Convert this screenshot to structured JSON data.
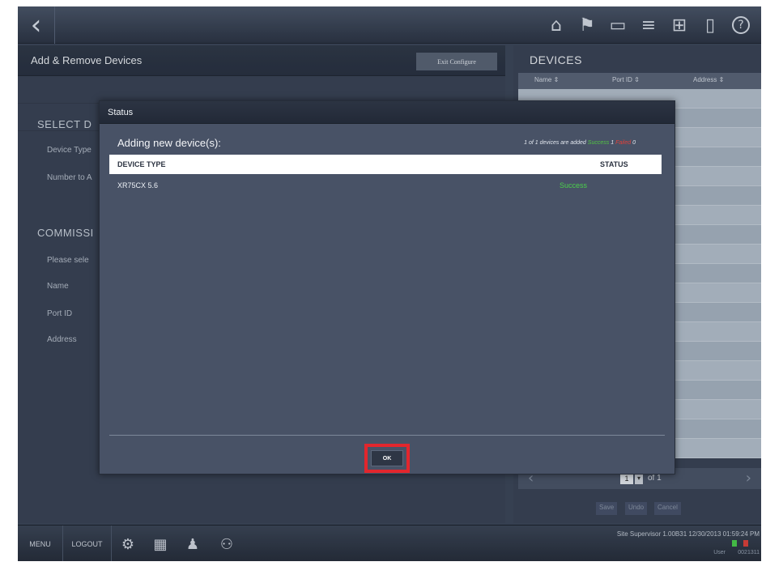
{
  "topbar": {
    "back_glyph": "‹",
    "icons": [
      {
        "name": "home-icon",
        "glyph": "⌂"
      },
      {
        "name": "flag-icon",
        "glyph": "⚑"
      },
      {
        "name": "display-icon",
        "glyph": "▭"
      },
      {
        "name": "list-icon",
        "glyph": "≡"
      },
      {
        "name": "network-icon",
        "glyph": "⊞"
      },
      {
        "name": "book-icon",
        "glyph": "▯"
      },
      {
        "name": "help-icon",
        "glyph": "?"
      }
    ]
  },
  "left_panel": {
    "title": "Add & Remove Devices",
    "exit_label": "Exit Configure",
    "select_section": "SELECT D",
    "device_type_label": "Device Type",
    "number_label": "Number to A",
    "commission_section": "COMMISSI",
    "please_label": "Please sele",
    "name_label": "Name",
    "port_label": "Port ID",
    "address_label": "Address"
  },
  "right_panel": {
    "title": "DEVICES",
    "columns": [
      "Name ⇕",
      "Port ID ⇕",
      "Address ⇕"
    ],
    "page_value": "1",
    "page_of": "of 1",
    "actions": [
      "Save",
      "Undo",
      "Cancel"
    ]
  },
  "dialog": {
    "title": "Status",
    "heading": "Adding new device(s):",
    "summary_prefix": "1 of 1 devices are added",
    "summary_success_label": "Success",
    "summary_success_count": "1",
    "summary_failed_label": "Failed",
    "summary_failed_count": "0",
    "columns": {
      "device_type": "DEVICE TYPE",
      "status": "STATUS"
    },
    "rows": [
      {
        "device_type": "XR75CX 5.6",
        "status": "Success"
      }
    ],
    "ok_label": "OK"
  },
  "bottombar": {
    "menu_label": "MENU",
    "logout_label": "LOGOUT",
    "status_text": "Site Supervisor 1.00B31 12/30/2013 01:59:24 PM",
    "user_label": "User",
    "user_value": "0021311"
  },
  "colors": {
    "success": "#4bd04b",
    "failure": "#e0403a",
    "highlight": "#e2262d"
  }
}
